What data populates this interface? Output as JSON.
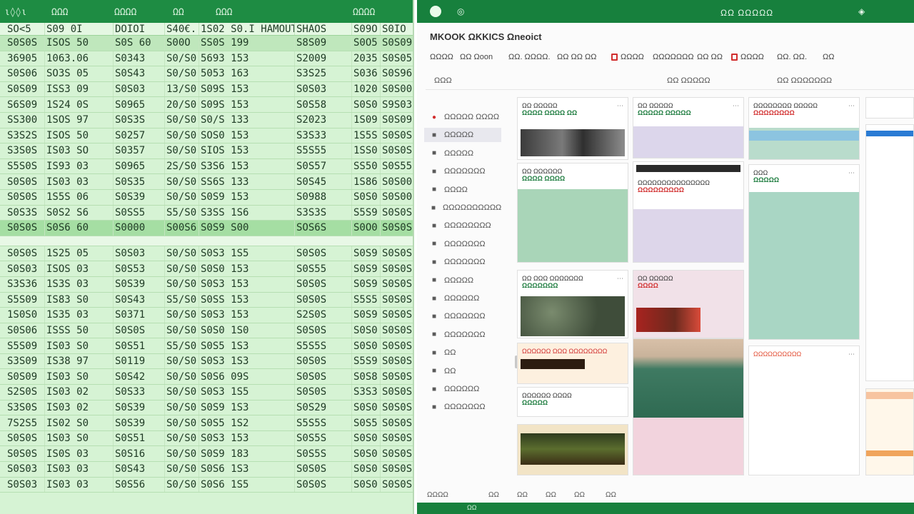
{
  "sheet": {
    "top_labels": [
      "ι◊◊ι",
      "ΩΩΩ",
      "ΩΩΩΩ",
      "ΩΩ",
      "ΩΩΩ",
      "ΩΩΩΩ"
    ],
    "header": [
      "SO<5",
      "S09 0I",
      "DOIOI",
      "S40€.",
      "1S02 S0.I",
      "SHAOS",
      "S09O",
      "S0IO"
    ],
    "header_extra": "HAMOUT",
    "rows": [
      [
        "S0S0S",
        "ISOS 50",
        "S0S 60",
        "S00O",
        "SS0S 199",
        "S8S09",
        "S0O5",
        "S0S09"
      ],
      [
        "36905",
        "1063.06",
        "S0343",
        "S0/S0",
        "5693 153",
        "S2009",
        "2035",
        "S0S05"
      ],
      [
        "S0S06",
        "SO3S 05",
        "S0S43",
        "S0/S0",
        "5053 163",
        "S3S25",
        "S036",
        "S0S96"
      ],
      [
        "S0S09",
        "ISS3 09",
        "S0S03",
        "13/S0",
        "S09S 153",
        "S0S03",
        "1020",
        "S0S00"
      ],
      [
        "S6S09",
        "1S24 0S",
        "S0965",
        "20/S0",
        "S09S 153",
        "S0S58",
        "S0S0",
        "S9S03"
      ],
      [
        "SS300",
        "1SOS 97",
        "S0S3S",
        "S0/S0",
        "S0/S 133",
        "S2023",
        "1S09",
        "S0S09"
      ],
      [
        "S3S2S",
        "ISOS 50",
        "S0257",
        "S0/S0",
        "SOS0 153",
        "S3S33",
        "1S5S",
        "S0S0S"
      ],
      [
        "S3S0S",
        "IS03 SO",
        "S0357",
        "S0/S0",
        "SIOS 153",
        "S5S55",
        "1SS0",
        "S0S0S"
      ],
      [
        "S5S0S",
        "IS93 03",
        "S0965",
        "2S/S0",
        "S3S6 153",
        "S0S57",
        "SS50",
        "S0S55"
      ],
      [
        "S0S0S",
        "IS03 03",
        "S0S35",
        "S0/S0",
        "SS6S 133",
        "S0S45",
        "1S86",
        "S0S00"
      ],
      [
        "S0S0S",
        "1S5S 06",
        "S0S39",
        "S0/S0",
        "S0S9 153",
        "S0988",
        "S0S0",
        "S0S00"
      ],
      [
        "S0S3S",
        "S0S2 S6",
        "S0SS5",
        "S5/S0",
        "S3SS 1S6",
        "S3S3S",
        "S5S9",
        "S0S0S"
      ]
    ],
    "hl_row": [
      "S0S0S",
      "S0S6 60",
      "S0000",
      "S00S6",
      "S0S9 S00",
      "SOS6S",
      "S0O0",
      "S0S0S"
    ],
    "rows2": [
      [
        "S0S0S",
        "1S25 05",
        "S0S03",
        "S0/S0",
        "S0S3 1S5",
        "S0S0S",
        "S0S9",
        "S0S0S"
      ],
      [
        "S0S03",
        "ISOS 03",
        "S0S53",
        "S0/S0",
        "S0S0 153",
        "S0S55",
        "S0S9",
        "S0S0S"
      ],
      [
        "S3S36",
        "1S3S 03",
        "S0S39",
        "S0/S0",
        "S0S3 153",
        "S0S0S",
        "S0S9",
        "S0S0S"
      ],
      [
        "S5S09",
        "IS83 S0",
        "S0S43",
        "S5/S0",
        "S0SS 153",
        "S0S0S",
        "S5S5",
        "S0S0S"
      ],
      [
        "1S0S0",
        "1S35 03",
        "S0371",
        "S0/S0",
        "S0S3 153",
        "S2S0S",
        "S0S9",
        "S0S0S"
      ],
      [
        "S0S06",
        "ISSS 50",
        "S0S0S",
        "S0/S0",
        "S0S0 1S0",
        "S0S0S",
        "S0S0",
        "S0S0S"
      ],
      [
        "S5S09",
        "IS03 S0",
        "S0S51",
        "S5/S0",
        "S0S5 1S3",
        "S5S5S",
        "S0S0",
        "S0S0S"
      ],
      [
        "S3S09",
        "IS38 97",
        "S0119",
        "S0/S0",
        "S0S3 1S3",
        "S0S0S",
        "S5S9",
        "S0S0S"
      ],
      [
        "S0S09",
        "IS03 S0",
        "S0S42",
        "S0/S0",
        "S0S6 09S",
        "S0S0S",
        "S0S8",
        "S0S0S"
      ],
      [
        "S2S0S",
        "IS03 02",
        "S0S33",
        "S0/S0",
        "S0S3 1S5",
        "S0S0S",
        "S3S3",
        "S0S0S"
      ],
      [
        "S3S0S",
        "IS03 02",
        "S0S39",
        "S0/S0",
        "S0S9 1S3",
        "S0S29",
        "S0S0",
        "S0S0S"
      ],
      [
        "7S2S5",
        "IS02 S0",
        "S0S39",
        "S0/S0",
        "S0S5 1S2",
        "S5S5S",
        "S0S5",
        "S0S0S"
      ],
      [
        "S0S0S",
        "1S03 S0",
        "S0S51",
        "S0/S0",
        "S0S3 153",
        "S0S5S",
        "S0S0",
        "S0S0S"
      ],
      [
        "S0S0S",
        "IS0S 03",
        "S0S16",
        "S0/S0",
        "S0S9 183",
        "S0S5S",
        "S0S0",
        "S0S0S"
      ],
      [
        "S0S03",
        "IS03 03",
        "S0S43",
        "S0/S0",
        "S0S6 1S3",
        "S0S0S",
        "S0S0",
        "S0S0S"
      ],
      [
        "S0S03",
        "IS03 03",
        "S0S56",
        "S0/S0",
        "S0S6 1S5",
        "S0S0S",
        "S0S0",
        "S0S0S"
      ]
    ]
  },
  "app": {
    "window_title": "ΩΩ ΩΩΩΩΩ",
    "doc_title": "MKOOK ΩKKICS Ωneoict",
    "ribbon": [
      {
        "label": "ΩΩΩΩ",
        "icon": "none"
      },
      {
        "label": "ΩΩ Ωoon",
        "icon": "none"
      },
      {
        "label": "ΩΩ. ΩΩΩΩ.",
        "icon": "none"
      },
      {
        "label": "ΩΩ ΩΩ ΩΩ",
        "icon": "none"
      },
      {
        "label": "ΩΩΩΩ",
        "icon": "red-square-icon"
      },
      {
        "label": "ΩΩΩΩΩΩΩ",
        "icon": "none"
      },
      {
        "label": "ΩΩ ΩΩ",
        "icon": "none"
      },
      {
        "label": "ΩΩΩΩ",
        "icon": "red-square-icon"
      },
      {
        "label": "ΩΩ. ΩΩ.",
        "icon": "none"
      },
      {
        "label": "ΩΩ",
        "icon": "none"
      }
    ],
    "viewbar": [
      "ΩΩΩ",
      "ΩΩ  ΩΩΩΩΩ",
      "ΩΩ  ΩΩΩΩΩΩΩ"
    ],
    "sidebar": [
      {
        "label": "ΩΩΩΩΩ ΩΩΩΩ",
        "icon": "red-icon"
      },
      {
        "label": "ΩΩΩΩΩ",
        "icon": "square-icon"
      },
      {
        "label": "ΩΩΩΩΩ",
        "icon": "square-icon"
      },
      {
        "label": "ΩΩΩΩΩΩΩ",
        "icon": "square-icon"
      },
      {
        "label": "ΩΩΩΩ",
        "icon": "square-icon"
      },
      {
        "label": "ΩΩΩΩΩΩΩΩΩΩ",
        "icon": "square-icon"
      },
      {
        "label": "ΩΩΩΩΩΩΩΩ",
        "icon": "square-icon"
      },
      {
        "label": "ΩΩΩΩΩΩΩ",
        "icon": "square-icon"
      },
      {
        "label": "ΩΩΩΩΩΩΩ",
        "icon": "square-icon"
      },
      {
        "label": "ΩΩΩΩΩ",
        "icon": "square-icon"
      },
      {
        "label": "ΩΩΩΩΩΩ",
        "icon": "square-icon"
      },
      {
        "label": "ΩΩΩΩΩΩΩ",
        "icon": "square-icon"
      },
      {
        "label": "ΩΩΩΩΩΩΩ",
        "icon": "square-icon"
      },
      {
        "label": "ΩΩ",
        "icon": "square-icon"
      },
      {
        "label": "ΩΩ",
        "icon": "square-icon"
      },
      {
        "label": "ΩΩΩΩΩΩ",
        "icon": "square-icon"
      },
      {
        "label": "ΩΩΩΩΩΩΩ",
        "icon": "square-icon"
      }
    ],
    "columns": [
      {
        "cards": [
          {
            "heading": "ΩΩ ΩΩΩΩΩ",
            "sub": "ΩΩΩΩ ΩΩΩΩ ΩΩ",
            "image": "dark-photo",
            "tint": "#ffffff"
          },
          {
            "heading": "ΩΩ ΩΩΩΩΩΩ",
            "sub": "ΩΩΩΩ ΩΩΩΩ",
            "image": "none",
            "tint": "#a9d5b8"
          },
          {
            "heading": "ΩΩ ΩΩΩ ΩΩΩΩΩΩΩ",
            "sub": "ΩΩΩΩΩΩΩ",
            "image": "foliage-photo",
            "tint": "#ffffff"
          },
          {
            "heading": "ΩΩΩΩΩΩ ΩΩΩ ΩΩΩΩΩΩΩΩ",
            "sub": "",
            "image": "dark-strip",
            "tint": "#fdf0df"
          },
          {
            "heading": "ΩΩΩΩΩΩ ΩΩΩΩ",
            "sub": "ΩΩΩΩΩ",
            "image": "none",
            "tint": "#ffffff"
          },
          {
            "heading": "",
            "sub": "",
            "image": "foliage-photo",
            "tint": "#f2e4c6"
          }
        ]
      },
      {
        "cards": [
          {
            "heading": "ΩΩ ΩΩΩΩΩ",
            "sub": "ΩΩΩΩΩ ΩΩΩΩΩ",
            "image": "none",
            "tint": "#dcd6eb"
          },
          {
            "heading": "ΩΩΩΩΩΩΩΩΩΩΩΩΩΩΩ",
            "sub": "ΩΩΩΩΩΩΩΩΩ",
            "image": "none",
            "tint": "#ddd6ea"
          },
          {
            "heading": "ΩΩ ΩΩΩΩΩ",
            "sub": "ΩΩΩΩ",
            "image": "red-strip",
            "tint": "#f1e1e8"
          },
          {
            "heading": "",
            "sub": "",
            "image": "field-photo",
            "tint": "#f2d3dd"
          }
        ]
      },
      {
        "cards": [
          {
            "heading": "ΩΩΩΩΩΩΩΩ ΩΩΩΩΩ",
            "sub": "ΩΩΩΩΩΩΩΩ",
            "image": "blue-bar",
            "tint": "#b9dccc"
          },
          {
            "heading": "ΩΩΩ",
            "sub": "ΩΩΩΩΩ",
            "image": "none",
            "tint": "#a9d6c4"
          },
          {
            "heading": "ΩΩΩΩΩΩΩΩΩΩ",
            "sub": "",
            "image": "none",
            "tint": "#ffffff"
          }
        ]
      }
    ],
    "bottombar": [
      "ΩΩΩΩ",
      "ΩΩ",
      "ΩΩ",
      "ΩΩ",
      "ΩΩ",
      "ΩΩ"
    ],
    "status": "ΩΩ"
  }
}
